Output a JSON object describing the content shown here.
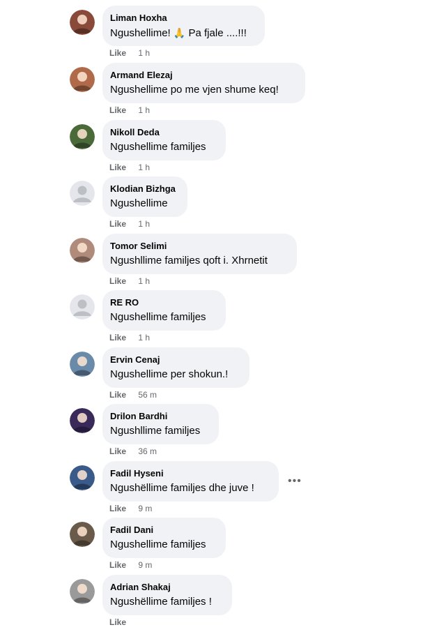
{
  "like_label": "Like",
  "comments": [
    {
      "author": "Liman Hoxha",
      "text": "Ngushellime!",
      "emoji": "🙏",
      "text_after": "Pa fjale ....!!!",
      "time": "1 h",
      "avatar_color": "#8a4a3a"
    },
    {
      "author": "Armand Elezaj",
      "text": "Ngushellime po me vjen shume keq!",
      "time": "1 h",
      "avatar_color": "#b06a4a"
    },
    {
      "author": "Nikoll Deda",
      "text": "Ngushellime familjes",
      "time": "1 h",
      "avatar_color": "#4a6a3a"
    },
    {
      "author": "Klodian Bizhga",
      "text": "Ngushellime",
      "time": "1 h",
      "avatar_color": "#c8ccd1"
    },
    {
      "author": "Tomor Selimi",
      "text": "Ngushllime familjes qoft i. Xhrnetit",
      "time": "1 h",
      "avatar_color": "#b08a7a"
    },
    {
      "author": "RE RO",
      "text": "Ngushellime familjes",
      "time": "1 h",
      "avatar_color": "#c8ccd1"
    },
    {
      "author": "Ervin Cenaj",
      "text": "Ngushellime per shokun.!",
      "time": "56 m",
      "avatar_color": "#6a8aaa"
    },
    {
      "author": "Drilon Bardhi",
      "text": "Ngushllime familjes",
      "time": "36 m",
      "avatar_color": "#3a2a5a"
    },
    {
      "author": "Fadil Hyseni",
      "text": "Ngushëllime familjes dhe juve !",
      "time": "9 m",
      "avatar_color": "#3a5a8a"
    },
    {
      "author": "Fadil Dani",
      "text": "Ngushellime familjes",
      "time": "9 m",
      "avatar_color": "#6a5a4a"
    },
    {
      "author": "Adrian Shakaj",
      "text": "Ngushëllime familjes !",
      "time": "",
      "avatar_color": "#9a9a9a"
    }
  ],
  "more_options_index": 8
}
